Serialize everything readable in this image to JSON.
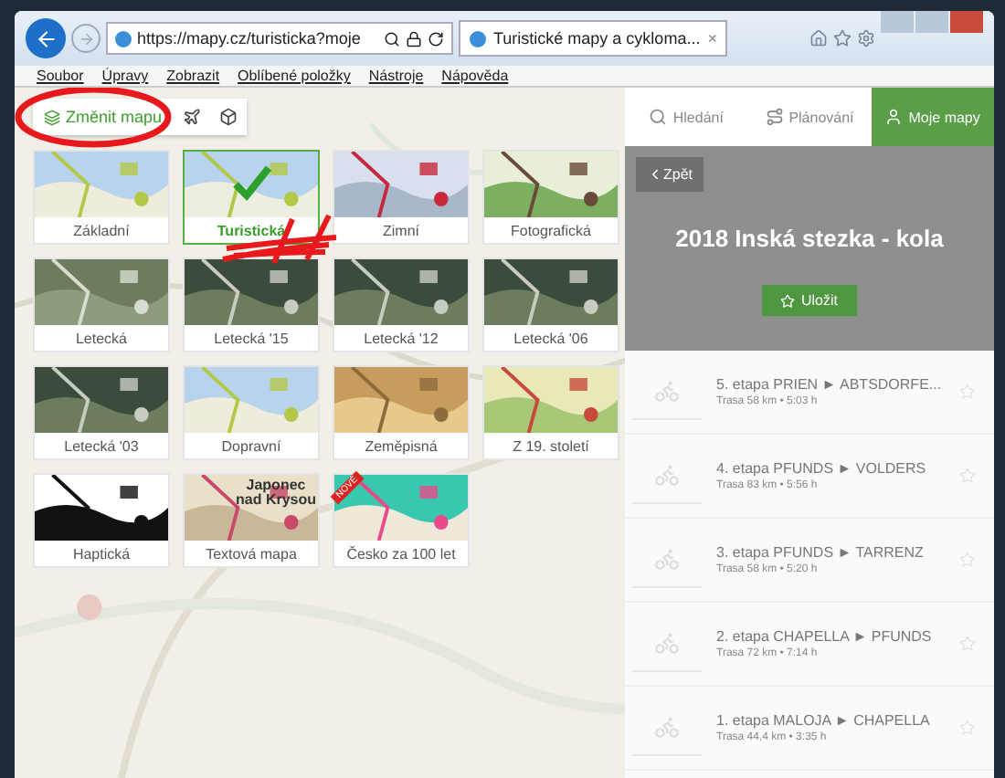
{
  "browser": {
    "url": "https://mapy.cz/turisticka?moje",
    "tab_title": "Turistické mapy a cykloma...",
    "tab_close": "×",
    "menu": [
      "Soubor",
      "Úpravy",
      "Zobrazit",
      "Oblíbené položky",
      "Nástroje",
      "Nápověda"
    ]
  },
  "map_toolbar": {
    "change_map": "Změnit mapu"
  },
  "map_types": [
    {
      "label": "Základní",
      "selected": false
    },
    {
      "label": "Turistická",
      "selected": true
    },
    {
      "label": "Zimní",
      "selected": false
    },
    {
      "label": "Fotografická",
      "selected": false
    },
    {
      "label": "Letecká",
      "selected": false
    },
    {
      "label": "Letecká '15",
      "selected": false
    },
    {
      "label": "Letecká '12",
      "selected": false
    },
    {
      "label": "Letecká '06",
      "selected": false
    },
    {
      "label": "Letecká '03",
      "selected": false
    },
    {
      "label": "Dopravní",
      "selected": false
    },
    {
      "label": "Zeměpisná",
      "selected": false
    },
    {
      "label": "Z 19. století",
      "selected": false
    },
    {
      "label": "Haptická",
      "selected": false
    },
    {
      "label": "Textová mapa",
      "selected": false,
      "thumb_text": "Japonec nad Krysou"
    },
    {
      "label": "Česko za 100 let",
      "selected": false,
      "badge": "NOVÉ"
    }
  ],
  "panel_tabs": [
    {
      "label": "Hledání",
      "selected": false
    },
    {
      "label": "Plánování",
      "selected": false
    },
    {
      "label": "Moje mapy",
      "selected": true
    }
  ],
  "folder": {
    "back": "Zpět",
    "title": "2018 Inská stezka - kola",
    "save": "Uložit"
  },
  "routes": [
    {
      "title": "5. etapa PRIEN ► ABTSDORFE...",
      "detail": "Trasa 58 km • 5:03 h"
    },
    {
      "title": "4. etapa PFUNDS ► VOLDERS",
      "detail": "Trasa 83 km • 5:56 h"
    },
    {
      "title": "3. etapa PFUNDS ► TARRENZ",
      "detail": "Trasa 58 km • 5:20 h"
    },
    {
      "title": "2. etapa CHAPELLA ► PFUNDS",
      "detail": "Trasa 72 km • 7:14 h"
    },
    {
      "title": "1. etapa MALOJA ► CHAPELLA",
      "detail": "Trasa 44,4 km • 3:35 h"
    }
  ]
}
